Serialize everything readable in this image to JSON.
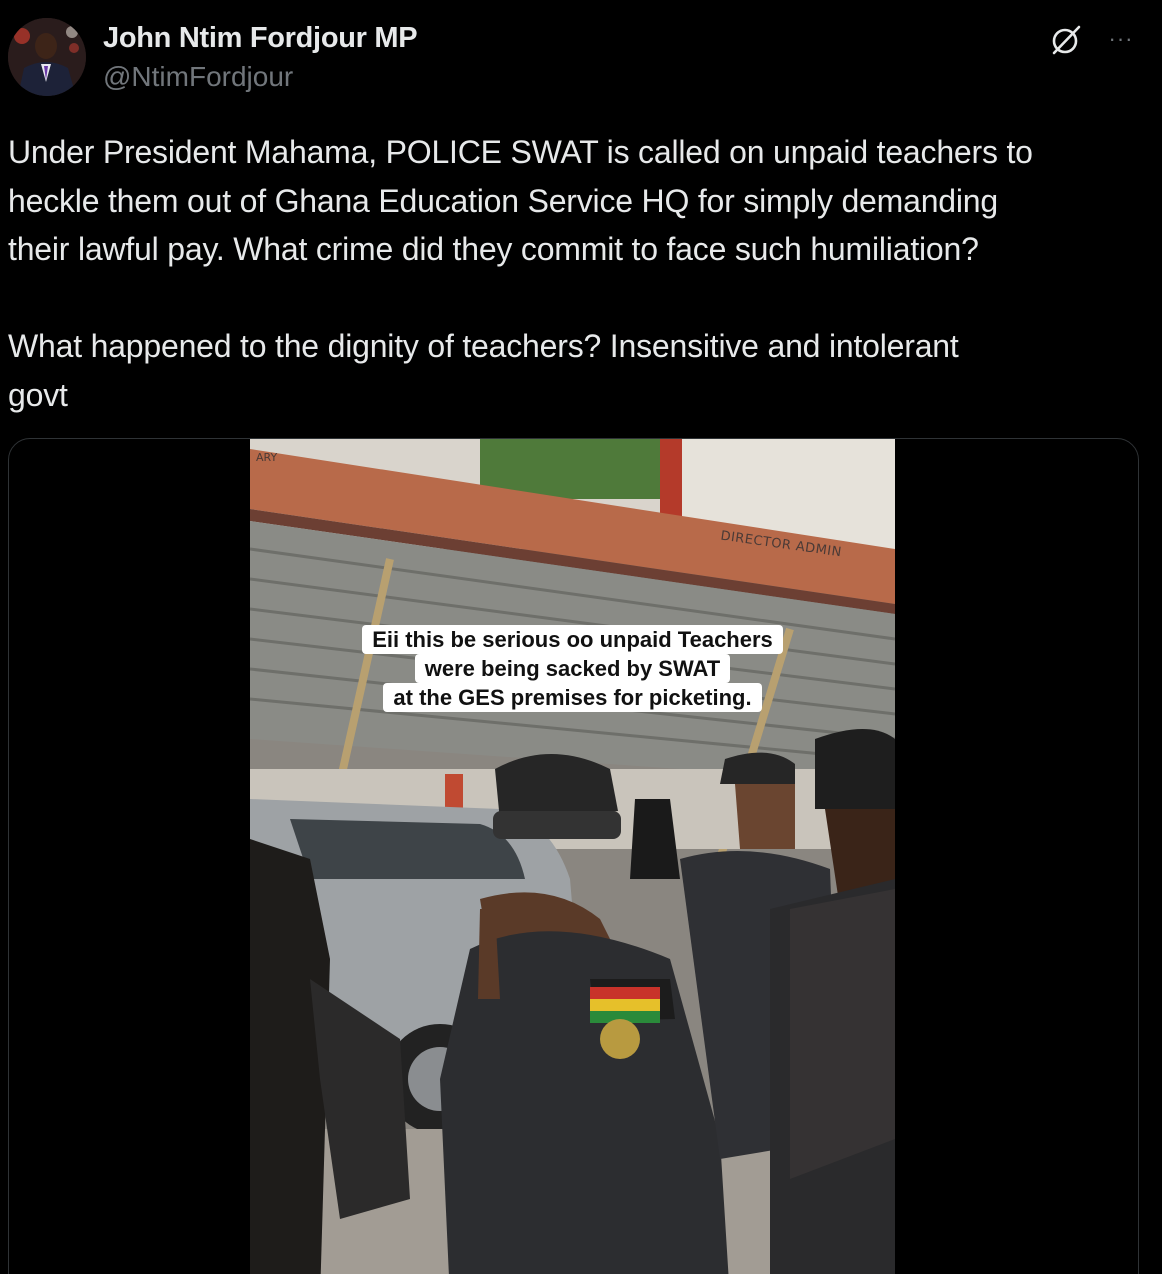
{
  "author": {
    "display_name": "John Ntim Fordjour MP",
    "handle": "@NtimFordjour",
    "avatar_icon": "profile-photo"
  },
  "header_icons": {
    "grok": "grok-icon",
    "more": "more-options-icon",
    "more_glyph": "···"
  },
  "tweet": {
    "text": "Under President Mahama, POLICE SWAT is called on unpaid teachers to\nheckle them out of Ghana Education Service HQ for simply demanding\ntheir lawful pay. What crime did they commit to face such humiliation?\n\nWhat happened to the dignity of teachers? Insensitive and intolerant\ngovt"
  },
  "media": {
    "caption_lines": [
      "Eii this be serious oo unpaid Teachers",
      "were being sacked by SWAT",
      "at the GES premises for picketing."
    ],
    "sign_text": "DIRECTOR ADMIN",
    "sign_text_left": "ARY"
  },
  "colors": {
    "background": "#000000",
    "text_primary": "#e7e9ea",
    "text_secondary": "#71767b",
    "border": "#2f3336"
  }
}
